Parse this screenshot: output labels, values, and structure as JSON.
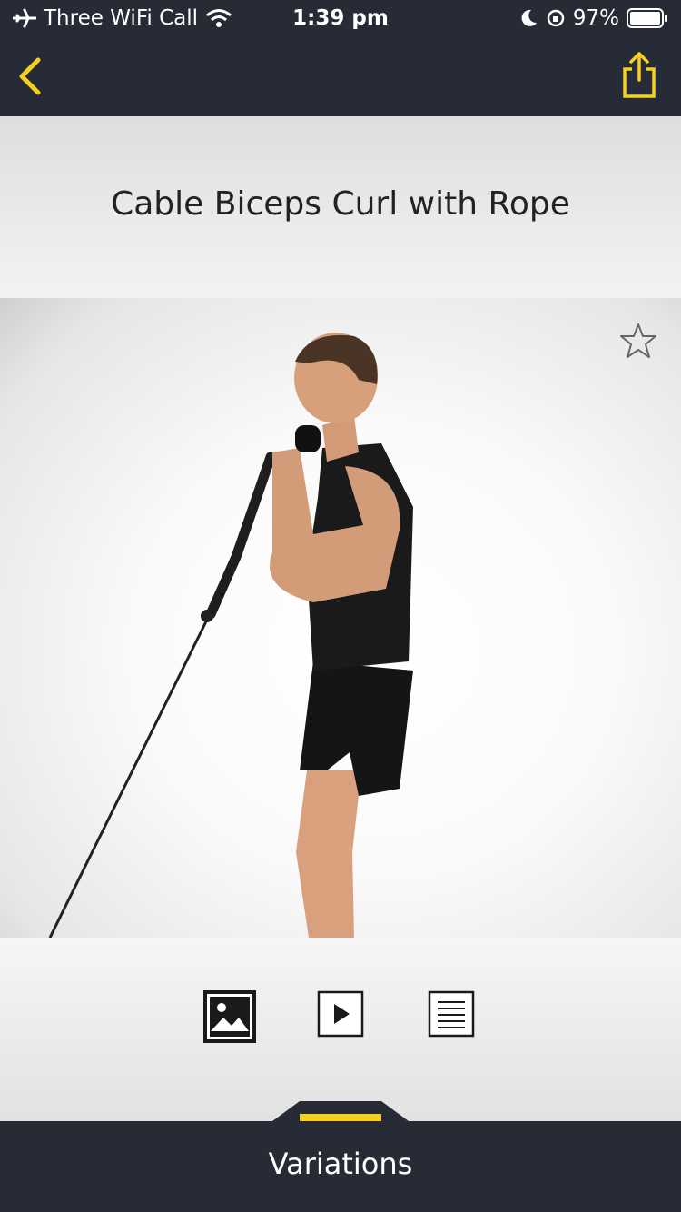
{
  "status_bar": {
    "carrier": "Three WiFi Call",
    "time": "1:39 pm",
    "battery": "97%"
  },
  "nav": {
    "back_icon": "chevron-left-icon",
    "share_icon": "share-icon"
  },
  "exercise": {
    "title": "Cable Biceps Curl with Rope"
  },
  "media_tabs": [
    {
      "name": "image",
      "icon": "image-icon"
    },
    {
      "name": "video",
      "icon": "play-icon"
    },
    {
      "name": "instructions",
      "icon": "document-icon"
    }
  ],
  "footer": {
    "label": "Variations"
  },
  "colors": {
    "accent": "#f5d020",
    "bar": "#262b36"
  }
}
